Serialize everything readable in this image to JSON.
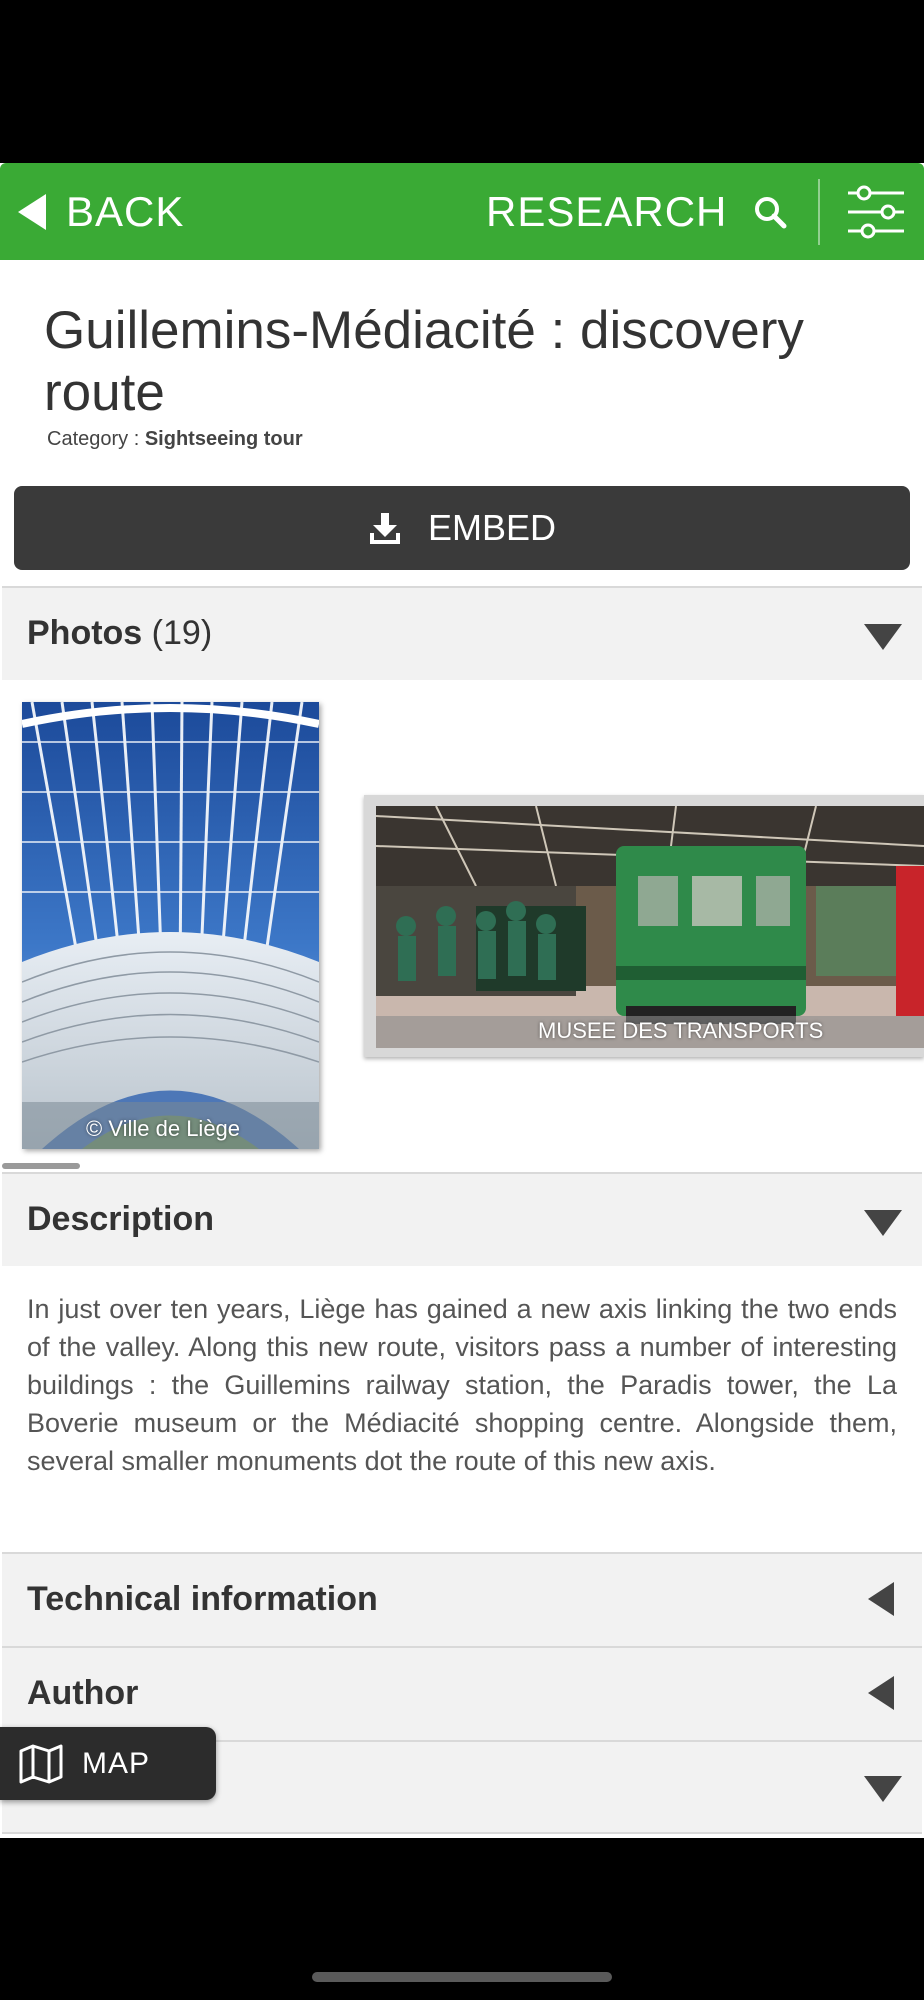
{
  "header": {
    "back_label": "BACK",
    "research_label": "RESEARCH",
    "accent_color": "#3aaa35",
    "icons": [
      "back-triangle-icon",
      "search-icon",
      "filter-sliders-icon"
    ]
  },
  "page": {
    "title": "Guillemins-Médiacité : discovery route",
    "category_label": "Category :",
    "category_value": "Sightseeing tour",
    "embed_label": "EMBED"
  },
  "photos": {
    "title": "Photos",
    "count": "(19)",
    "items": [
      {
        "caption": "© Ville de Liège"
      },
      {
        "caption": "MUSEE DES TRANSPORTS"
      }
    ]
  },
  "description": {
    "title": "Description",
    "text": "In just over ten years, Liège has gained a new axis linking the two ends of the valley. Along this new route, visitors pass a number of interesting buildings : the Guillemins railway station, the Paradis tower, the La Boverie museum or the Médiacité shopping centre. Alongside them, several smaller monuments dot the route of this new axis."
  },
  "sections": {
    "technical": "Technical information",
    "author": "Author"
  },
  "map_button": {
    "label": "MAP"
  }
}
